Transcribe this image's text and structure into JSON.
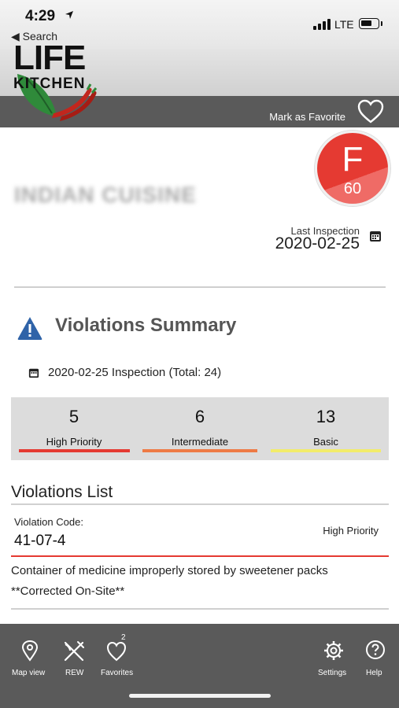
{
  "status": {
    "time": "4:29",
    "back_label": "◀ Search",
    "network": "LTE"
  },
  "logo": {
    "line1": "LIFE",
    "line2": "KITCHEN"
  },
  "header": {
    "favorite_label": "Mark as Favorite"
  },
  "restaurant": {
    "name": "INDIAN CUISINE",
    "grade": "F",
    "score": "60",
    "last_inspection_label": "Last Inspection",
    "last_inspection_date": "2020-02-25"
  },
  "summary": {
    "title": "Violations Summary",
    "inspection_line": "2020-02-25 Inspection (Total: 24)",
    "stats": [
      {
        "value": "5",
        "label": "High Priority",
        "color": "#e53a32"
      },
      {
        "value": "6",
        "label": "Intermediate",
        "color": "#ee7a45"
      },
      {
        "value": "13",
        "label": "Basic",
        "color": "#f2ec6a"
      }
    ]
  },
  "violations": {
    "title": "Violations List",
    "items": [
      {
        "code_label": "Violation Code:",
        "code": "41-07-4",
        "priority": "High Priority",
        "description": "Container of medicine improperly stored by sweetener packs",
        "note": "**Corrected On-Site**"
      }
    ]
  },
  "nav": {
    "items": [
      {
        "label": "Map view",
        "icon": "map-pin-icon"
      },
      {
        "label": "REW",
        "icon": "fork-knife-icon"
      },
      {
        "label": "Favorites",
        "icon": "heart-icon",
        "badge": "2"
      },
      {
        "label": "Settings",
        "icon": "gear-icon"
      },
      {
        "label": "Help",
        "icon": "help-icon"
      }
    ]
  },
  "colors": {
    "grade_red": "#e53a32",
    "nav_bg": "#5a5a5a"
  }
}
